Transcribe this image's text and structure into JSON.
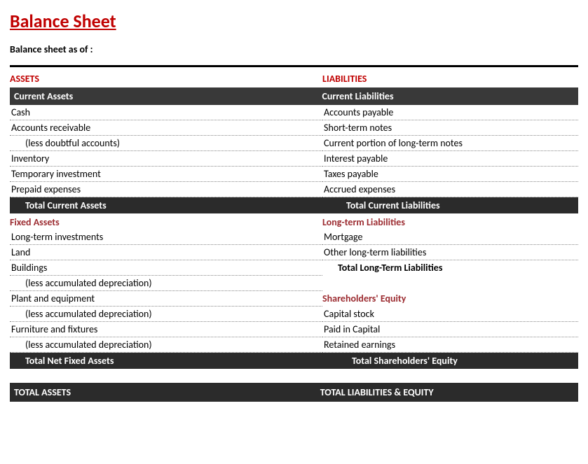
{
  "title": "Balance Sheet",
  "subtitle": "Balance sheet as of :",
  "assets": {
    "heading": "ASSETS",
    "current": {
      "heading": "Current Assets",
      "items": [
        {
          "label": "Cash",
          "indent": false
        },
        {
          "label": "Accounts receivable",
          "indent": false
        },
        {
          "label": "(less doubtful accounts)",
          "indent": true
        },
        {
          "label": "Inventory",
          "indent": false
        },
        {
          "label": "Temporary investment",
          "indent": false
        },
        {
          "label": "Prepaid expenses",
          "indent": false
        }
      ],
      "total_label": "Total Current Assets"
    },
    "fixed": {
      "heading": "Fixed Assets",
      "items": [
        {
          "label": "Long-term investments",
          "indent": false
        },
        {
          "label": "Land",
          "indent": false
        },
        {
          "label": "Buildings",
          "indent": false
        },
        {
          "label": "(less accumulated depreciation)",
          "indent": true
        },
        {
          "label": "Plant and equipment",
          "indent": false
        },
        {
          "label": "(less accumulated depreciation)",
          "indent": true
        },
        {
          "label": "Furniture and fixtures",
          "indent": false
        },
        {
          "label": "(less accumulated depreciation)",
          "indent": true
        }
      ],
      "total_label": "Total Net Fixed Assets"
    },
    "grand_total": "TOTAL ASSETS"
  },
  "liabilities": {
    "heading": "LIABILITIES",
    "current": {
      "heading": "Current Liabilities",
      "items": [
        {
          "label": "Accounts payable"
        },
        {
          "label": "Short-term notes"
        },
        {
          "label": "Current portion of long-term notes"
        },
        {
          "label": "Interest payable"
        },
        {
          "label": "Taxes payable"
        },
        {
          "label": "Accrued expenses"
        }
      ],
      "total_label": "Total Current Liabilities"
    },
    "longterm": {
      "heading": "Long-term Liabilities",
      "items": [
        {
          "label": "Mortgage"
        },
        {
          "label": "Other long-term liabilities"
        }
      ],
      "total_label": "Total Long-Term Liabilities"
    },
    "equity": {
      "heading": "Shareholders' Equity",
      "items": [
        {
          "label": "Capital stock"
        },
        {
          "label": "Paid in Capital"
        },
        {
          "label": "Retained earnings"
        }
      ],
      "total_label": "Total Shareholders' Equity"
    },
    "grand_total": "TOTAL LIABILITIES & EQUITY"
  }
}
